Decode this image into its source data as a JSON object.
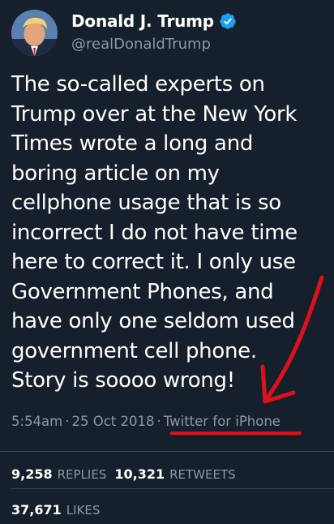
{
  "author": {
    "name": "Donald J. Trump",
    "handle": "@realDonaldTrump",
    "verified": true
  },
  "tweet": {
    "text": "The so-called experts on\nTrump over at the New York\nTimes wrote a long and\nboring article on my\ncellphone usage that is so\nincorrect I do not have time\nhere to correct it. I only use\nGovernment Phones, and\nhave only one seldom used\ngovernment cell phone.\nStory is soooo wrong!",
    "time": "5:54am",
    "date": "25 Oct 2018",
    "separator": "·",
    "source": "Twitter for iPhone"
  },
  "stats": {
    "replies_count": "9,258",
    "replies_label": "REPLIES",
    "retweets_count": "10,321",
    "retweets_label": "RETWEETS",
    "likes_count": "37,671",
    "likes_label": "LIKES"
  },
  "colors": {
    "background": "#16202c",
    "secondary_text": "#8899a6",
    "verified_blue": "#1da1f2",
    "annotation_red": "#e0101a"
  },
  "icons": [
    "verified-badge-icon"
  ]
}
